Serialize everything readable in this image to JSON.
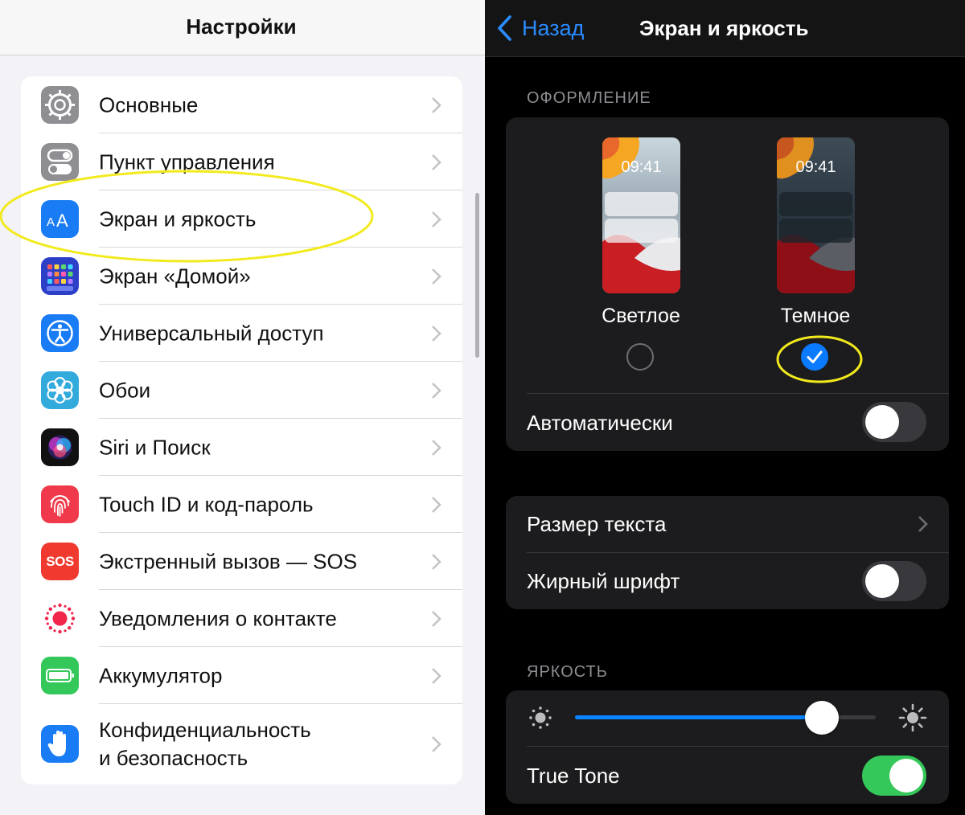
{
  "left": {
    "title": "Настройки",
    "items": [
      {
        "label": "Основные",
        "icon": "gear-icon",
        "color": "#8e8e93"
      },
      {
        "label": "Пункт управления",
        "icon": "toggles-icon",
        "color": "#8e8e93"
      },
      {
        "label": "Экран и яркость",
        "icon": "text-size-icon",
        "color": "#1a7cf5",
        "highlighted": true
      },
      {
        "label": "Экран «Домой»",
        "icon": "home-grid-icon",
        "color": "#2c3fc7"
      },
      {
        "label": "Универсальный доступ",
        "icon": "accessibility-icon",
        "color": "#1a7cf5"
      },
      {
        "label": "Обои",
        "icon": "flower-icon",
        "color": "#33aadc"
      },
      {
        "label": "Siri и Поиск",
        "icon": "siri-icon",
        "color": "#111111"
      },
      {
        "label": "Touch ID и код-пароль",
        "icon": "fingerprint-icon",
        "color": "#f03a4b"
      },
      {
        "label": "Экстренный вызов — SOS",
        "icon": "sos-icon",
        "color": "#f03a2f",
        "icon_text": "SOS"
      },
      {
        "label": "Уведомления о контакте",
        "icon": "exposure-icon",
        "color": "#ffffff"
      },
      {
        "label": "Аккумулятор",
        "icon": "battery-icon",
        "color": "#34c759"
      },
      {
        "label_line1": "Конфиденциальность",
        "label_line2": "и безопасность",
        "icon": "hand-icon",
        "color": "#1a7cf5"
      }
    ]
  },
  "right": {
    "back_label": "Назад",
    "title": "Экран и яркость",
    "appearance_header": "ОФОРМЛЕНИЕ",
    "light_label": "Светлое",
    "dark_label": "Темное",
    "preview_time": "09:41",
    "selected_mode": "dark",
    "automatic_label": "Автоматически",
    "automatic_on": false,
    "text_size_label": "Размер текста",
    "bold_text_label": "Жирный шрифт",
    "bold_text_on": false,
    "brightness_header": "ЯРКОСТЬ",
    "brightness_level": 0.82,
    "true_tone_label": "True Tone",
    "true_tone_on": true
  },
  "colors": {
    "accent": "#0a84ff",
    "toggle_on": "#34c759",
    "highlight": "#f2ea1d"
  }
}
